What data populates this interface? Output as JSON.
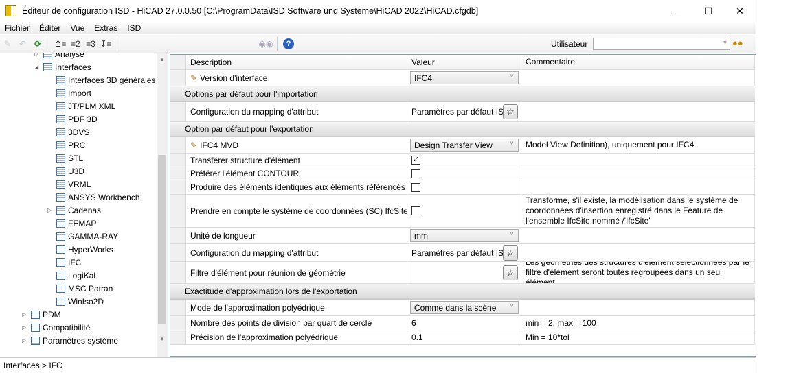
{
  "window": {
    "title": "Éditeur de configuration ISD  - HiCAD 27.0.0.50 [C:\\ProgramData\\ISD Software und Systeme\\HiCAD 2022\\HiCAD.cfgdb]"
  },
  "menu": [
    "Fichier",
    "Éditer",
    "Vue",
    "Extras",
    "ISD"
  ],
  "toolbar": {
    "user_label": "Utilisateur",
    "user_value": ""
  },
  "tree": [
    {
      "label": "Analyse",
      "level": 1,
      "arrow": "collapsed"
    },
    {
      "label": "Interfaces",
      "level": 1,
      "arrow": "expanded"
    },
    {
      "label": "Interfaces 3D générales",
      "level": 2
    },
    {
      "label": "Import",
      "level": 2
    },
    {
      "label": "JT/PLM XML",
      "level": 2
    },
    {
      "label": "PDF 3D",
      "level": 2
    },
    {
      "label": "3DVS",
      "level": 2
    },
    {
      "label": "PRC",
      "level": 2
    },
    {
      "label": "STL",
      "level": 2
    },
    {
      "label": "U3D",
      "level": 2
    },
    {
      "label": "VRML",
      "level": 2
    },
    {
      "label": "ANSYS Workbench",
      "level": 2
    },
    {
      "label": "Cadenas",
      "level": 2,
      "arrow": "collapsed"
    },
    {
      "label": "FEMAP",
      "level": 2
    },
    {
      "label": "GAMMA-RAY",
      "level": 2
    },
    {
      "label": "HyperWorks",
      "level": 2
    },
    {
      "label": "IFC",
      "level": 2,
      "selected": true
    },
    {
      "label": "LogiKal",
      "level": 2
    },
    {
      "label": "MSC Patran",
      "level": 2
    },
    {
      "label": "WinIso2D",
      "level": 2
    },
    {
      "label": "PDM",
      "level": 0,
      "arrow": "collapsed"
    },
    {
      "label": "Compatibilité",
      "level": 0,
      "arrow": "collapsed"
    },
    {
      "label": "Paramètres système",
      "level": 0,
      "arrow": "collapsed"
    }
  ],
  "grid": {
    "headers": [
      "Description",
      "Valeur",
      "Commentaire"
    ],
    "rows": [
      {
        "type": "row",
        "desc": "Version d'interface",
        "pencil": true,
        "value": "IFC4",
        "control": "combo",
        "comment": ""
      },
      {
        "type": "section",
        "desc": "Options par défaut pour l'importation"
      },
      {
        "type": "row",
        "desc": "Configuration du mapping d'attribut",
        "value": "Paramètres par défaut IS",
        "control": "star",
        "comment": ""
      },
      {
        "type": "section",
        "desc": "Option par défaut pour l'exportation"
      },
      {
        "type": "row",
        "desc": "IFC4 MVD",
        "pencil": true,
        "value": "Design Transfer View",
        "control": "combo",
        "comment": "Model View Definition), uniquement pour IFC4"
      },
      {
        "type": "row",
        "desc": "Transférer structure d'élément",
        "control": "check",
        "checked": true,
        "comment": ""
      },
      {
        "type": "row",
        "desc": "Préférer l'élément CONTOUR",
        "control": "check",
        "checked": false,
        "comment": ""
      },
      {
        "type": "row",
        "desc": "Produire des éléments identiques aux éléments référencés",
        "control": "check",
        "checked": false,
        "comment": ""
      },
      {
        "type": "row",
        "desc": "Prendre en compte le système de coordonnées (SC) IfcSite",
        "control": "check",
        "checked": false,
        "comment": "Transforme, s'il existe, la modélisation dans le système de coordonnées d'insertion enregistré dans le Feature de l'ensemble IfcSite nommé /'IfcSite'"
      },
      {
        "type": "row",
        "desc": "Unité de longueur",
        "value": "mm",
        "control": "combo",
        "comment": ""
      },
      {
        "type": "row",
        "desc": "Configuration du mapping d'attribut",
        "value": "Paramètres par défaut IS",
        "control": "star",
        "comment": ""
      },
      {
        "type": "row",
        "desc": "Filtre d'élément pour réunion de géométrie",
        "value": "",
        "control": "star",
        "comment": "Les géométries des structures d'élément sélectionnées par le filtre d'élément seront toutes regroupées dans un seul élément."
      },
      {
        "type": "section",
        "desc": "Exactitude d'approximation lors de l'exportation"
      },
      {
        "type": "row",
        "desc": "Mode de l'approximation polyédrique",
        "value": "Comme dans la scène",
        "control": "combo",
        "comment": ""
      },
      {
        "type": "row",
        "desc": "Nombre des points de division par quart de cercle",
        "value": "6",
        "control": "text",
        "comment": "min = 2; max = 100"
      },
      {
        "type": "row",
        "desc": "Précision de l'approximation polyédrique",
        "value": "0.1",
        "control": "text",
        "comment": "Min = 10*tol"
      }
    ]
  },
  "status": "Interfaces > IFC"
}
